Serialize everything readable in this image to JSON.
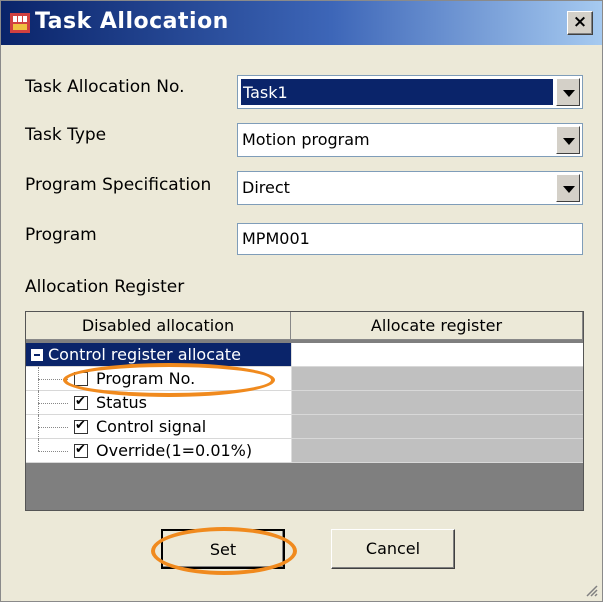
{
  "window": {
    "title": "Task Allocation",
    "close_label": "×"
  },
  "fields": {
    "task_allocation_no": {
      "label": "Task Allocation No.",
      "value": "Task1"
    },
    "task_type": {
      "label": "Task Type",
      "value": "Motion program"
    },
    "program_spec": {
      "label": "Program Specification",
      "value": "Direct"
    },
    "program": {
      "label": "Program",
      "value": "MPM001"
    }
  },
  "allocation": {
    "label": "Allocation Register",
    "columns": [
      "Disabled allocation",
      "Allocate register"
    ],
    "parent": {
      "label": "Control register allocate"
    },
    "children": [
      {
        "label": "Program No.",
        "checked": false
      },
      {
        "label": "Status",
        "checked": true
      },
      {
        "label": "Control signal",
        "checked": true
      },
      {
        "label": "Override(1=0.01%)",
        "checked": true
      }
    ]
  },
  "buttons": {
    "set": "Set",
    "cancel": "Cancel"
  },
  "colors": {
    "titlebar": "#0a246a",
    "selection": "#0a246a",
    "highlight": "#f08a1e"
  }
}
